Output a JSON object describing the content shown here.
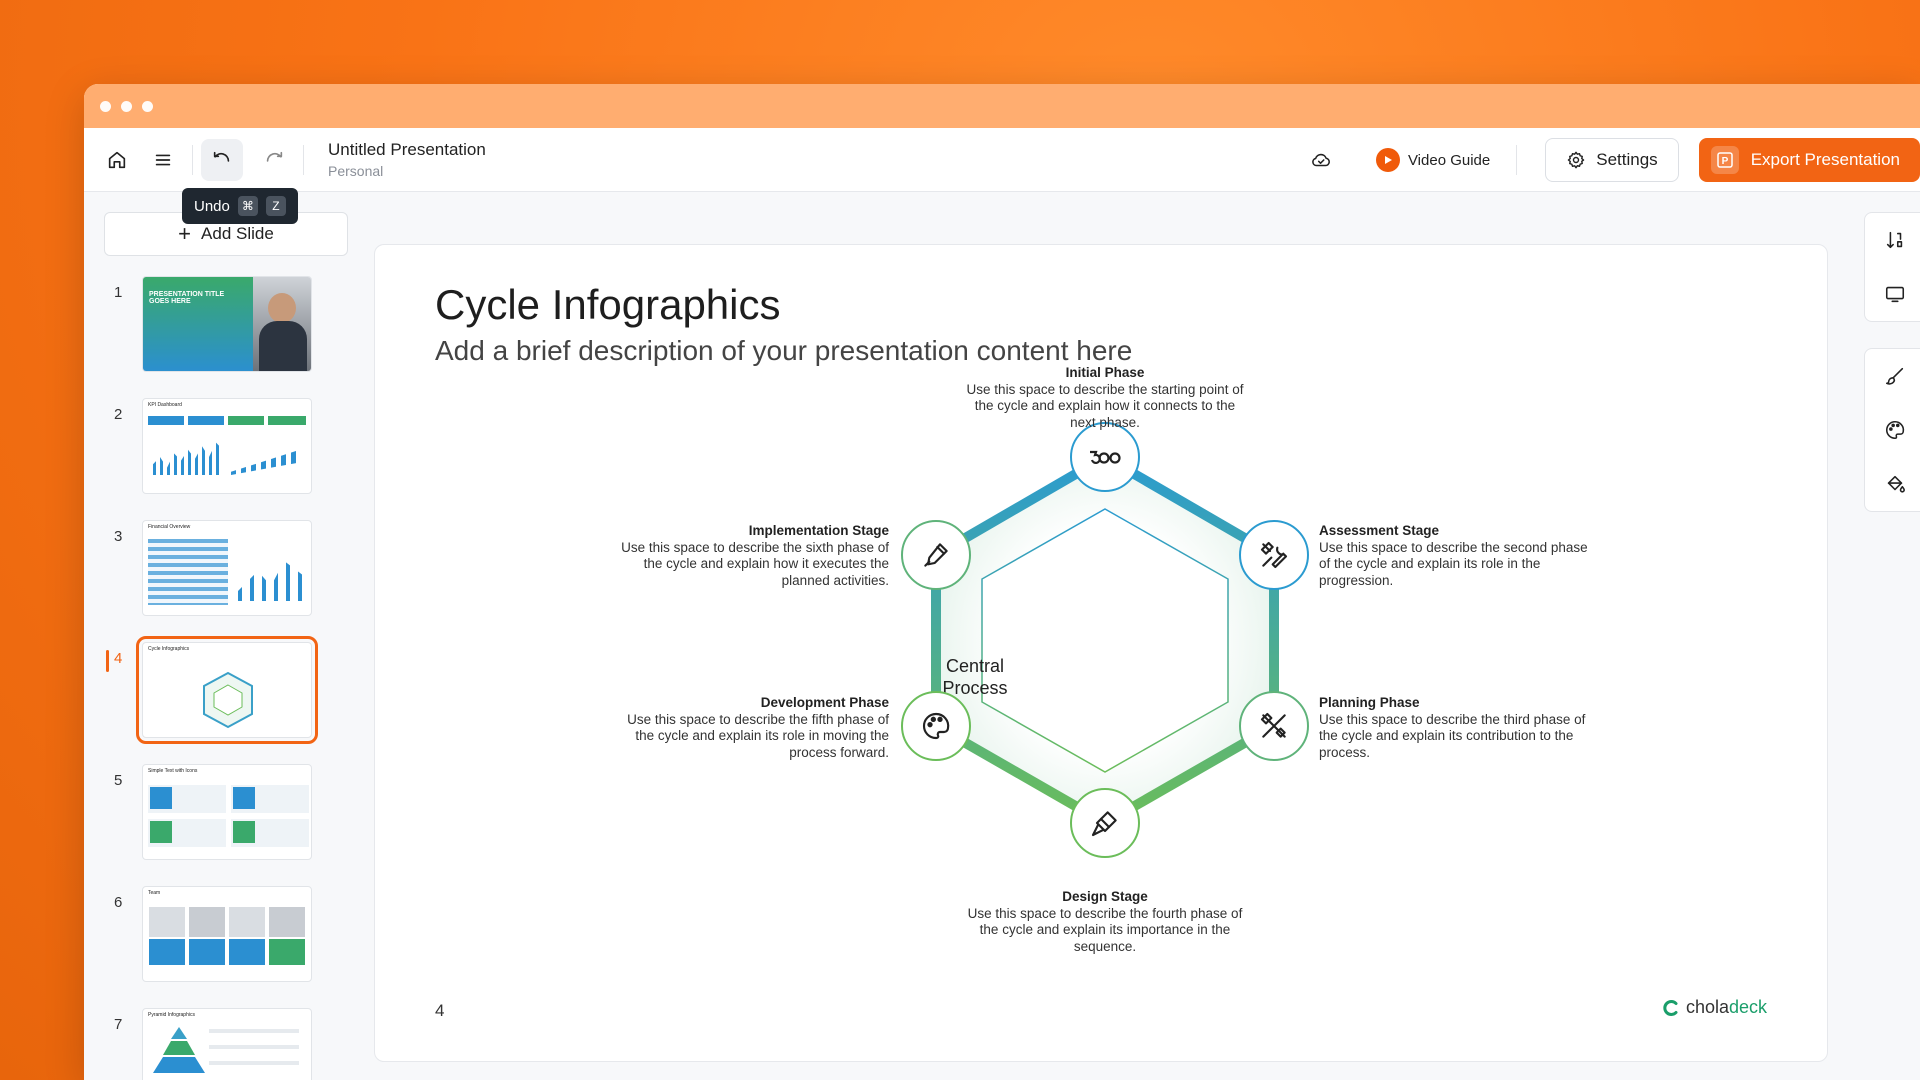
{
  "app": {
    "doc_title": "Untitled Presentation",
    "workspace": "Personal",
    "video_guide_label": "Video Guide",
    "settings_label": "Settings",
    "export_label": "Export Presentation",
    "tooltip": {
      "label": "Undo",
      "keys": [
        "⌘",
        "Z"
      ]
    },
    "colors": {
      "accent": "#f26414",
      "brand_green": "#1a9e6a",
      "cycle_blue": "#2b9bd0",
      "cycle_green": "#6bbd5a"
    }
  },
  "sidebar": {
    "add_slide_label": "Add Slide",
    "slides": [
      {
        "number": "1",
        "title": "PRESENTATION TITLE GOES HERE",
        "active": false
      },
      {
        "number": "2",
        "title": "KPI Dashboard",
        "active": false
      },
      {
        "number": "3",
        "title": "Financial Overview",
        "active": false
      },
      {
        "number": "4",
        "title": "Cycle Infographics",
        "active": true
      },
      {
        "number": "5",
        "title": "Simple Text with Icons",
        "active": false
      },
      {
        "number": "6",
        "title": "Team",
        "active": false
      },
      {
        "number": "7",
        "title": "Pyramid Infographics",
        "active": false
      }
    ]
  },
  "slide": {
    "title": "Cycle Infographics",
    "subtitle": "Add a brief description of your presentation content here",
    "center": [
      "Central",
      "Process"
    ],
    "page_number": "4",
    "brand": {
      "part1": "chola",
      "part2": "deck"
    },
    "phases": {
      "initial": {
        "title": "Initial Phase",
        "lines": [
          "Use this space to describe the starting point of",
          "the cycle and explain how it connects to the",
          "next phase."
        ],
        "icon": "infinity-icon"
      },
      "assessment": {
        "title": "Assessment Stage",
        "lines": [
          "Use this space to describe the second phase",
          "of the cycle and explain its role in the",
          "progression."
        ],
        "icon": "tools-icon"
      },
      "planning": {
        "title": "Planning Phase",
        "lines": [
          "Use this space to describe the third phase of",
          "the cycle and explain its contribution to the",
          "process."
        ],
        "icon": "crossed-tools-icon"
      },
      "design": {
        "title": "Design Stage",
        "lines": [
          "Use this space to describe the fourth phase of",
          "the cycle and explain its importance in the",
          "sequence."
        ],
        "icon": "paint-brush-icon"
      },
      "development": {
        "title": "Development Phase",
        "lines": [
          "Use this space to describe the fifth phase of",
          "the cycle and explain its role in moving the",
          "process forward."
        ],
        "icon": "palette-icon"
      },
      "implementation": {
        "title": "Implementation Stage",
        "lines": [
          "Use this space to describe the sixth phase of",
          "the cycle and explain how it executes the",
          "planned activities."
        ],
        "icon": "pen-tool-icon"
      }
    }
  }
}
